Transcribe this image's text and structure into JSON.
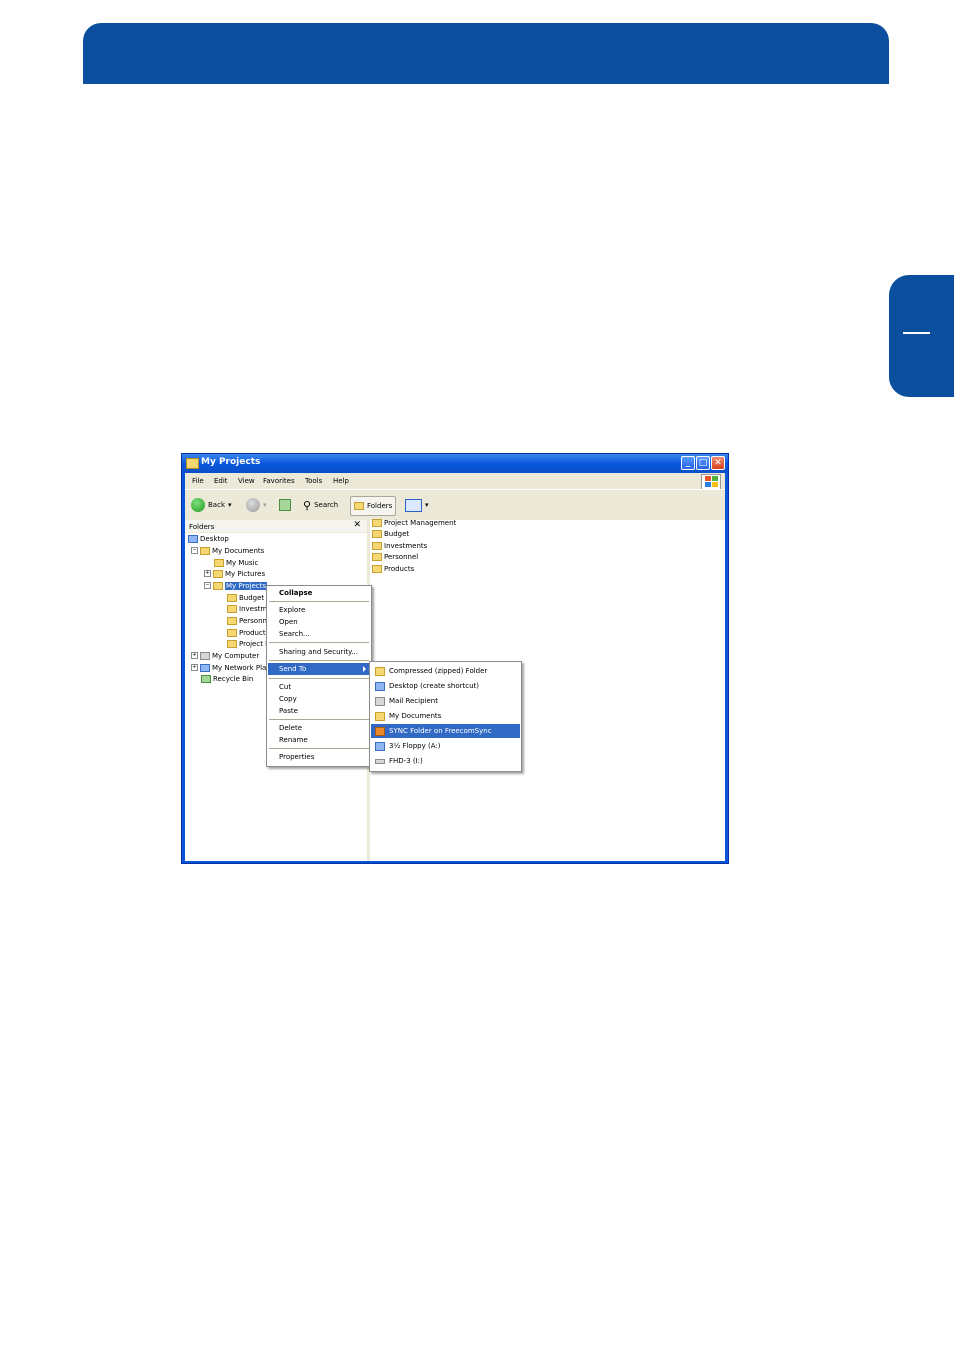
{
  "window": {
    "title": "My Projects",
    "menu": [
      "File",
      "Edit",
      "View",
      "Favorites",
      "Tools",
      "Help"
    ],
    "toolbar": {
      "back": "Back",
      "search": "Search",
      "folders": "Folders"
    }
  },
  "folders_pane": {
    "header": "Folders",
    "close": "✕",
    "tree": [
      "Desktop",
      "My Documents",
      "My Music",
      "My Pictures",
      "My Projects",
      "Budget",
      "Investm",
      "Personn",
      "Product",
      "Project I",
      "My Computer",
      "My Network Pla",
      "Recycle Bin"
    ]
  },
  "content_pane": {
    "items": [
      "Project Management",
      "Budget",
      "Investments",
      "Personnel",
      "Products"
    ]
  },
  "context_menu": {
    "items": [
      "Collapse",
      "Explore",
      "Open",
      "Search...",
      "Sharing and Security...",
      "Send To",
      "Cut",
      "Copy",
      "Paste",
      "Delete",
      "Rename",
      "Properties"
    ]
  },
  "send_to_menu": {
    "items": [
      "Compressed (zipped) Folder",
      "Desktop (create shortcut)",
      "Mail Recipient",
      "My Documents",
      "SYNC Folder on FreecomSync",
      "3½ Floppy (A:)",
      "FHD-3 (I:)"
    ]
  },
  "colors": {
    "brand": "#0b4f9e",
    "highlight": "#316ac5"
  }
}
